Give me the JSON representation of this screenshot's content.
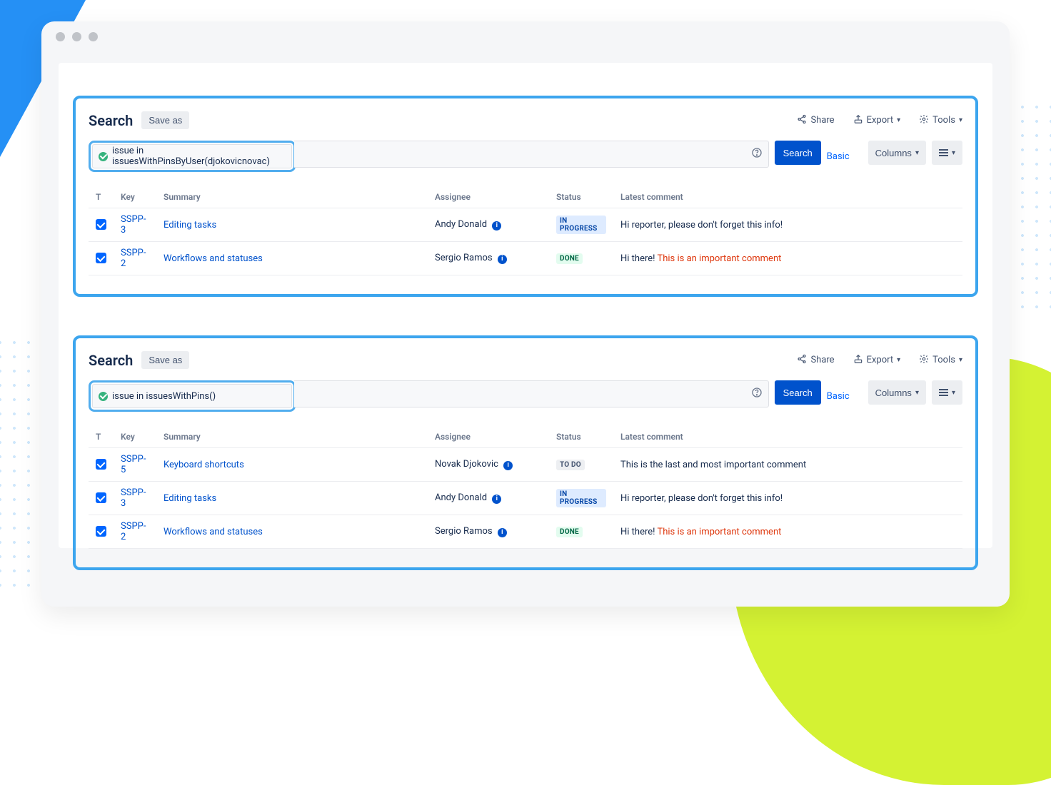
{
  "panels": [
    {
      "title": "Search",
      "saveAs": "Save as",
      "share": "Share",
      "export": "Export",
      "tools": "Tools",
      "query": "issue in issuesWithPinsByUser(djokovicnovac)",
      "searchBtn": "Search",
      "basic": "Basic",
      "columns": "Columns",
      "headers": {
        "t": "T",
        "key": "Key",
        "summary": "Summary",
        "assignee": "Assignee",
        "status": "Status",
        "latest": "Latest comment"
      },
      "rows": [
        {
          "key": "SSPP-3",
          "summary": "Editing tasks",
          "assignee": "Andy Donald",
          "status": "IN PROGRESS",
          "statusClass": "lz-inprogress",
          "comment": "Hi reporter, please don't forget this info!",
          "commentRed": ""
        },
        {
          "key": "SSPP-2",
          "summary": "Workflows and statuses",
          "assignee": "Sergio Ramos",
          "status": "DONE",
          "statusClass": "lz-done",
          "comment": "Hi there! ",
          "commentRed": "This is an important comment"
        }
      ]
    },
    {
      "title": "Search",
      "saveAs": "Save as",
      "share": "Share",
      "export": "Export",
      "tools": "Tools",
      "query": "issue in issuesWithPins()",
      "searchBtn": "Search",
      "basic": "Basic",
      "columns": "Columns",
      "headers": {
        "t": "T",
        "key": "Key",
        "summary": "Summary",
        "assignee": "Assignee",
        "status": "Status",
        "latest": "Latest comment"
      },
      "rows": [
        {
          "key": "SSPP-5",
          "summary": "Keyboard shortcuts",
          "assignee": "Novak Djokovic",
          "status": "TO DO",
          "statusClass": "lz-todo",
          "comment": "This is the last and most important comment",
          "commentRed": ""
        },
        {
          "key": "SSPP-3",
          "summary": "Editing tasks",
          "assignee": "Andy Donald",
          "status": "IN PROGRESS",
          "statusClass": "lz-inprogress",
          "comment": "Hi reporter, please don't forget this info!",
          "commentRed": ""
        },
        {
          "key": "SSPP-2",
          "summary": "Workflows and statuses",
          "assignee": "Sergio Ramos",
          "status": "DONE",
          "statusClass": "lz-done",
          "comment": "Hi there! ",
          "commentRed": "This is an important comment"
        }
      ]
    }
  ]
}
